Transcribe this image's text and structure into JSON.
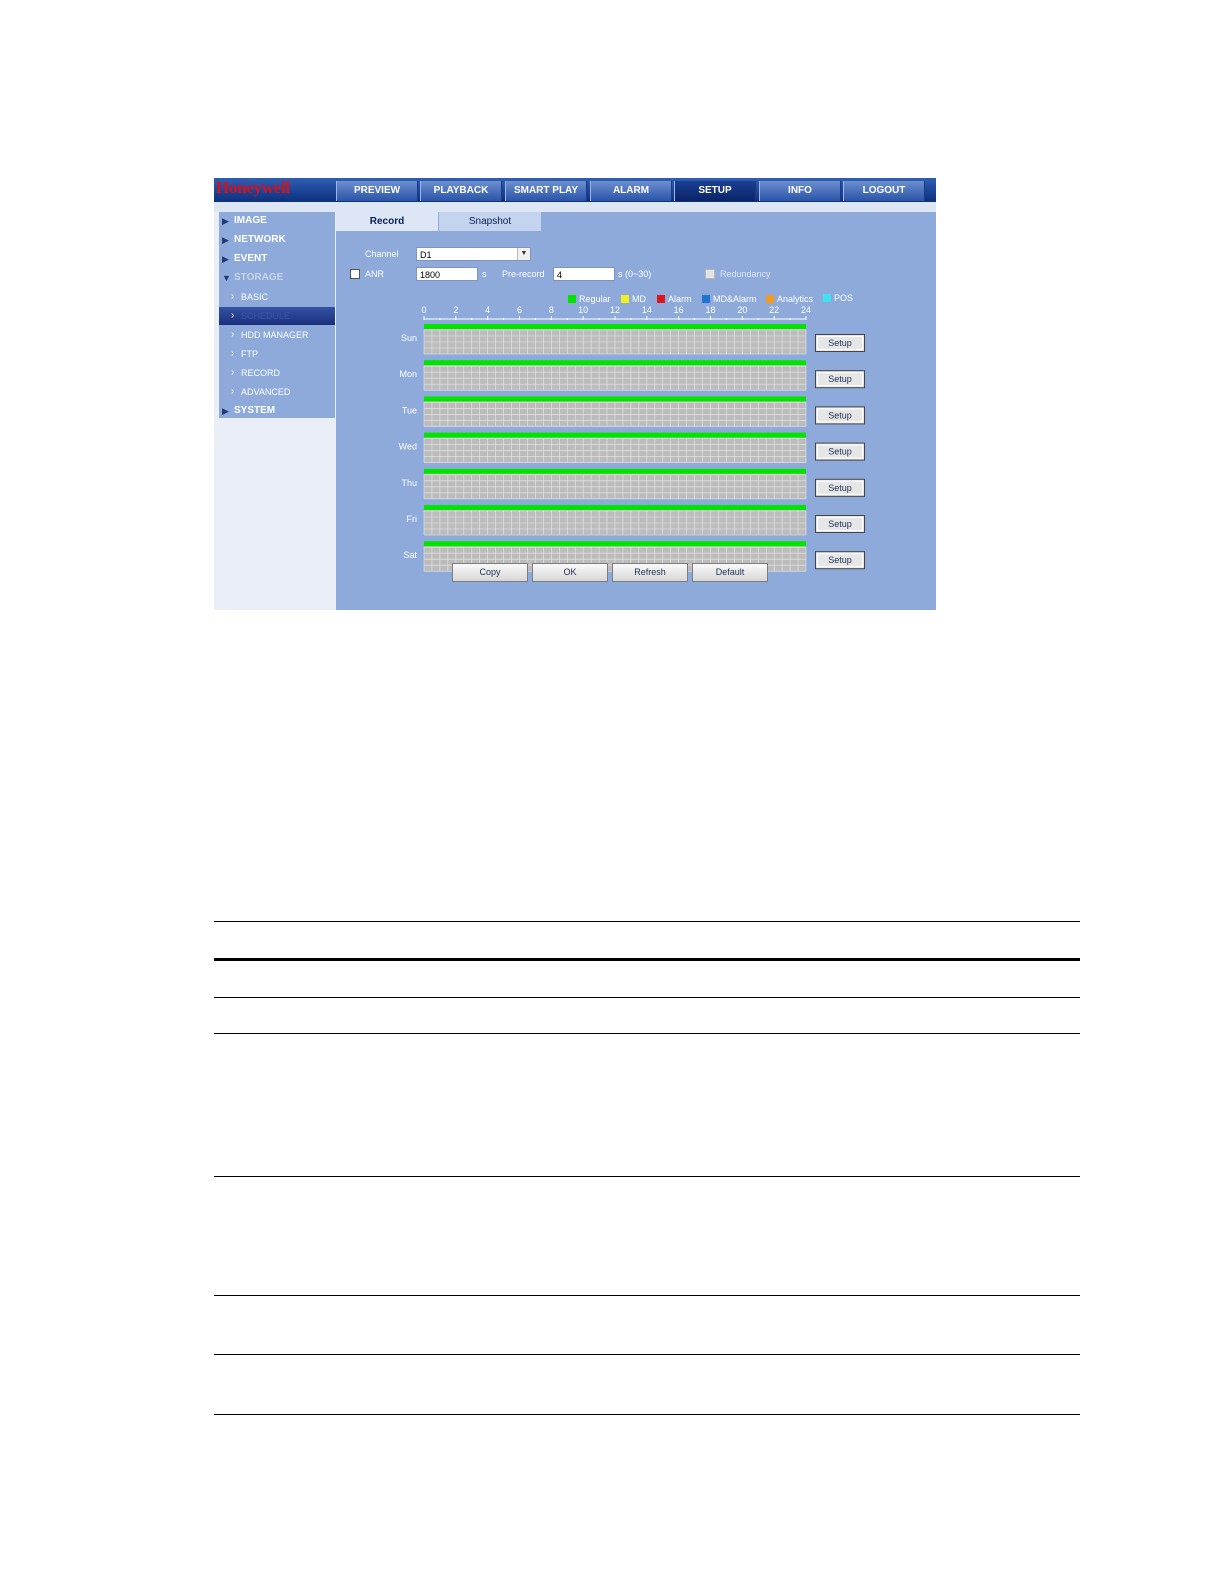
{
  "app": {
    "brand": "Honeywell",
    "nav_tabs": [
      {
        "label": "PREVIEW"
      },
      {
        "label": "PLAYBACK"
      },
      {
        "label": "SMART PLAY"
      },
      {
        "label": "ALARM"
      },
      {
        "label": "SETUP",
        "active": true
      },
      {
        "label": "INFO"
      },
      {
        "label": "LOGOUT"
      }
    ]
  },
  "sidebar": {
    "items": [
      {
        "label": "IMAGE",
        "icon": "triangle-right-icon"
      },
      {
        "label": "NETWORK",
        "icon": "triangle-right-icon"
      },
      {
        "label": "EVENT",
        "icon": "triangle-right-icon"
      },
      {
        "label": "STORAGE",
        "icon": "triangle-down-icon",
        "expanded": true
      },
      {
        "label": "BASIC",
        "icon": "chevron-right-icon"
      },
      {
        "label": "SCHEDULE",
        "icon": "chevron-right-icon",
        "selected": true
      },
      {
        "label": "HDD MANAGER",
        "icon": "chevron-right-icon"
      },
      {
        "label": "FTP",
        "icon": "chevron-right-icon"
      },
      {
        "label": "RECORD",
        "icon": "chevron-right-icon"
      },
      {
        "label": "ADVANCED",
        "icon": "chevron-right-icon"
      },
      {
        "label": "SYSTEM",
        "icon": "triangle-right-icon"
      }
    ]
  },
  "tabs": {
    "record": "Record",
    "snapshot": "Snapshot"
  },
  "form": {
    "channel_label": "Channel",
    "channel_value": "D1",
    "anr_label": "ANR",
    "anr_checked": false,
    "anr_value": "1800",
    "anr_unit": "s",
    "prerecord_label": "Pre-record",
    "prerecord_value": "4",
    "prerecord_unit": "s (0~30)",
    "redundancy_label": "Redundancy",
    "redundancy_enabled": false
  },
  "legend": [
    {
      "label": "Regular",
      "color": "#00e400"
    },
    {
      "label": "MD",
      "color": "#f3ee1c"
    },
    {
      "label": "Alarm",
      "color": "#e0141b"
    },
    {
      "label": "MD&Alarm",
      "color": "#1f74d3"
    },
    {
      "label": "Analytics",
      "color": "#f39a1e"
    },
    {
      "label": "POS",
      "color": "#3fe0f0"
    }
  ],
  "schedule": {
    "hour_labels": [
      "0",
      "2",
      "4",
      "6",
      "8",
      "10",
      "12",
      "14",
      "16",
      "18",
      "20",
      "22",
      "24"
    ],
    "days": [
      {
        "label": "Sun",
        "regular": [
          [
            0,
            24
          ]
        ]
      },
      {
        "label": "Mon",
        "regular": [
          [
            0,
            24
          ]
        ]
      },
      {
        "label": "Tue",
        "regular": [
          [
            0,
            24
          ]
        ]
      },
      {
        "label": "Wed",
        "regular": [
          [
            0,
            24
          ]
        ]
      },
      {
        "label": "Thu",
        "regular": [
          [
            0,
            24
          ]
        ]
      },
      {
        "label": "Fri",
        "regular": [
          [
            0,
            24
          ]
        ]
      },
      {
        "label": "Sat",
        "regular": [
          [
            0,
            24
          ]
        ]
      }
    ],
    "setup_label": "Setup"
  },
  "buttons": {
    "copy": "Copy",
    "ok": "OK",
    "refresh": "Refresh",
    "default": "Default"
  }
}
